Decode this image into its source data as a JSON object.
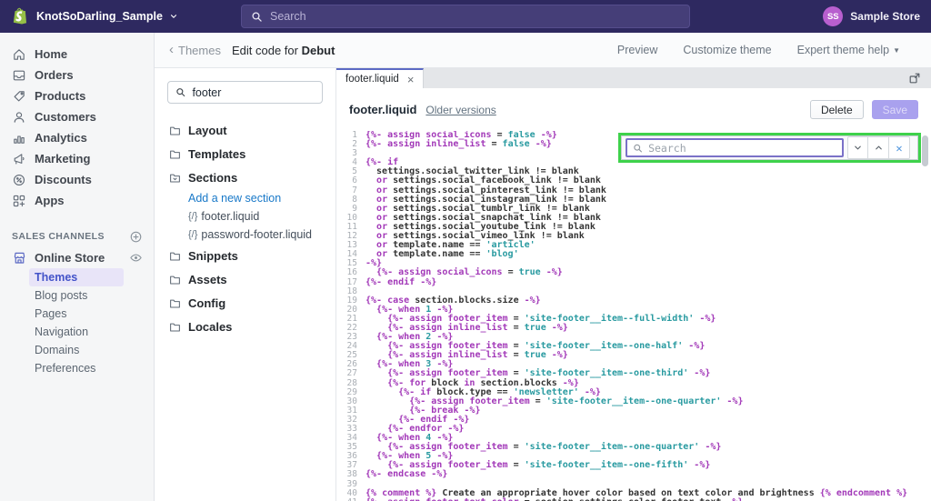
{
  "topbar": {
    "store_name": "KnotSoDarling_Sample",
    "search_placeholder": "Search",
    "user_initials": "SS",
    "user_name": "Sample Store"
  },
  "sidebar": {
    "items": [
      {
        "label": "Home",
        "icon": "home"
      },
      {
        "label": "Orders",
        "icon": "orders"
      },
      {
        "label": "Products",
        "icon": "products"
      },
      {
        "label": "Customers",
        "icon": "customers"
      },
      {
        "label": "Analytics",
        "icon": "analytics"
      },
      {
        "label": "Marketing",
        "icon": "marketing"
      },
      {
        "label": "Discounts",
        "icon": "discounts"
      },
      {
        "label": "Apps",
        "icon": "apps"
      }
    ],
    "sales_channels_label": "SALES CHANNELS",
    "online_store_label": "Online Store",
    "online_store_items": [
      {
        "label": "Themes",
        "active": true
      },
      {
        "label": "Blog posts",
        "active": false
      },
      {
        "label": "Pages",
        "active": false
      },
      {
        "label": "Navigation",
        "active": false
      },
      {
        "label": "Domains",
        "active": false
      },
      {
        "label": "Preferences",
        "active": false
      }
    ]
  },
  "subheader": {
    "back_label": "Themes",
    "title_prefix": "Edit code for ",
    "title_theme": "Debut",
    "actions": [
      "Preview",
      "Customize theme",
      "Expert theme help"
    ]
  },
  "file_tree": {
    "search_value": "footer",
    "items": [
      {
        "type": "folder",
        "label": "Layout"
      },
      {
        "type": "folder",
        "label": "Templates"
      },
      {
        "type": "folder-open",
        "label": "Sections"
      },
      {
        "type": "link",
        "label": "Add a new section"
      },
      {
        "type": "file",
        "label": "footer.liquid"
      },
      {
        "type": "file",
        "label": "password-footer.liquid"
      },
      {
        "type": "folder",
        "label": "Snippets"
      },
      {
        "type": "folder",
        "label": "Assets"
      },
      {
        "type": "folder",
        "label": "Config"
      },
      {
        "type": "folder",
        "label": "Locales"
      }
    ],
    "file_prefix": "{/}"
  },
  "editor": {
    "tab_label": "footer.liquid",
    "tab_close": "×",
    "file_title": "footer.liquid",
    "older_versions_label": "Older versions",
    "delete_label": "Delete",
    "save_label": "Save",
    "find_placeholder": "Search",
    "find_close": "✕"
  },
  "colors": {
    "topbar_bg": "#2e2960",
    "accent_indigo": "#5c6ac4",
    "logo_green": "#95bf47",
    "avatar_pink": "#b85fcf",
    "find_highlight_green": "#3ed24b",
    "link_blue": "#1878c8",
    "syntax_keyword": "#a238b8",
    "syntax_string": "#289aa0",
    "save_disabled_bg": "#a9a1ee"
  },
  "code": {
    "lines": [
      "{%- assign social_icons = false -%}",
      "{%- assign inline_list = false -%}",
      "",
      "{%- if",
      "  settings.social_twitter_link != blank",
      "  or settings.social_facebook_link != blank",
      "  or settings.social_pinterest_link != blank",
      "  or settings.social_instagram_link != blank",
      "  or settings.social_tumblr_link != blank",
      "  or settings.social_snapchat_link != blank",
      "  or settings.social_youtube_link != blank",
      "  or settings.social_vimeo_link != blank",
      "  or template.name == 'article'",
      "  or template.name == 'blog'",
      "-%}",
      "  {%- assign social_icons = true -%}",
      "{%- endif -%}",
      "",
      "{%- case section.blocks.size -%}",
      "  {%- when 1 -%}",
      "    {%- assign footer_item = 'site-footer__item--full-width' -%}",
      "    {%- assign inline_list = true -%}",
      "  {%- when 2 -%}",
      "    {%- assign footer_item = 'site-footer__item--one-half' -%}",
      "    {%- assign inline_list = true -%}",
      "  {%- when 3 -%}",
      "    {%- assign footer_item = 'site-footer__item--one-third' -%}",
      "    {%- for block in section.blocks -%}",
      "      {%- if block.type == 'newsletter' -%}",
      "        {%- assign footer_item = 'site-footer__item--one-quarter' -%}",
      "        {%- break -%}",
      "      {%- endif -%}",
      "    {%- endfor -%}",
      "  {%- when 4 -%}",
      "    {%- assign footer_item = 'site-footer__item--one-quarter' -%}",
      "  {%- when 5 -%}",
      "    {%- assign footer_item = 'site-footer__item--one-fifth' -%}",
      "{%- endcase -%}",
      "",
      "{% comment %} Create an appropriate hover color based on text color and brightness {% endcomment %}",
      "{%- assign footer_text_color = section.settings.color_footer_text -%}"
    ]
  }
}
